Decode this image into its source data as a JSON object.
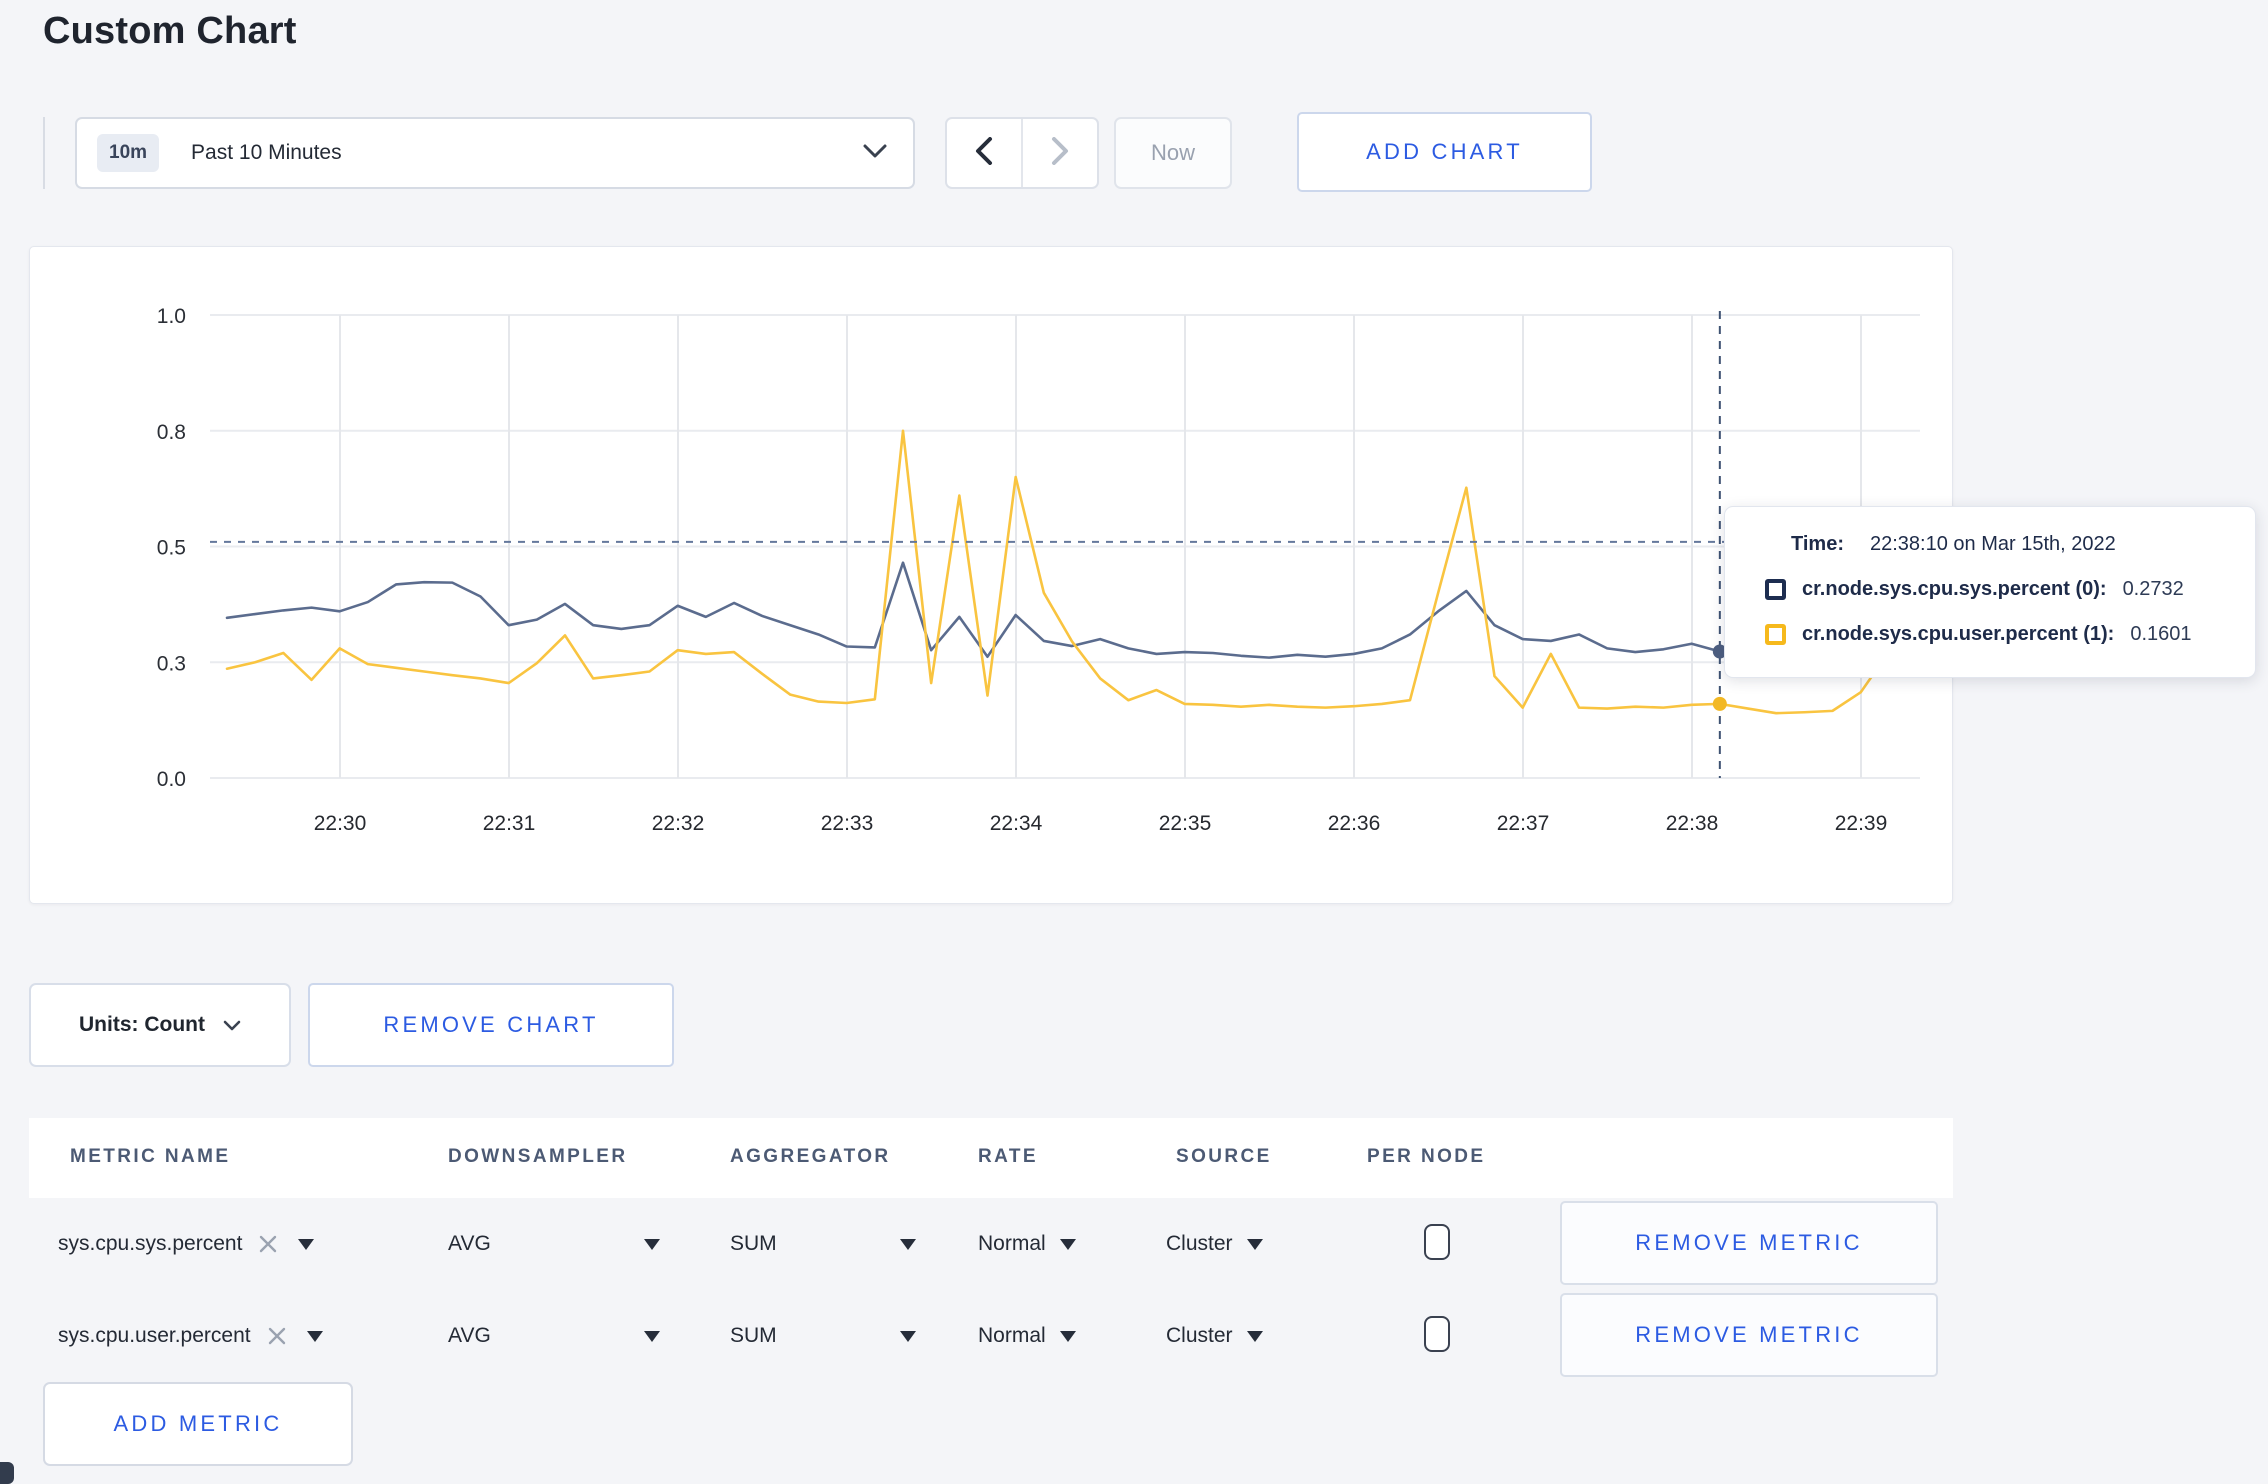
{
  "page": {
    "title": "Custom Chart",
    "background": "#f4f5f8",
    "accent_blue": "#2c5be2"
  },
  "toolbar": {
    "time_badge": "10m",
    "time_label": "Past 10 Minutes",
    "now_label": "Now",
    "add_chart_label": "ADD CHART"
  },
  "icons": {
    "time_dropdown": "chevron-down",
    "nav_prev": "chevron-left",
    "nav_next": "chevron-right",
    "units_dropdown": "chevron-down",
    "metric_clear": "x",
    "dropdown_caret": "caret-down"
  },
  "chart_data": {
    "type": "line",
    "title": "",
    "xlabel": "",
    "ylabel": "",
    "ylim": [
      0,
      1
    ],
    "grid": true,
    "x_ticks": [
      "22:30",
      "22:31",
      "22:32",
      "22:33",
      "22:34",
      "22:35",
      "22:36",
      "22:37",
      "22:38",
      "22:39"
    ],
    "y_ticks": {
      "labels": [
        "0.0",
        "0.3",
        "0.5",
        "0.8",
        "1.0"
      ],
      "values": [
        0,
        0.25,
        0.5,
        0.75,
        1.0
      ]
    },
    "x_start": "22:29:20",
    "x_end": "22:39:20",
    "step_seconds": 10,
    "series": [
      {
        "name": "cr.node.sys.cpu.sys.percent (0)",
        "color": "#5b6c8e",
        "values": [
          0.346,
          0.354,
          0.362,
          0.368,
          0.36,
          0.38,
          0.418,
          0.423,
          0.422,
          0.392,
          0.33,
          0.342,
          0.376,
          0.33,
          0.322,
          0.33,
          0.372,
          0.348,
          0.378,
          0.35,
          0.33,
          0.31,
          0.284,
          0.282,
          0.465,
          0.276,
          0.348,
          0.262,
          0.352,
          0.296,
          0.285,
          0.3,
          0.28,
          0.268,
          0.272,
          0.27,
          0.264,
          0.26,
          0.266,
          0.262,
          0.268,
          0.28,
          0.31,
          0.36,
          0.404,
          0.33,
          0.3,
          0.296,
          0.31,
          0.28,
          0.272,
          0.278,
          0.29,
          0.2732,
          0.266,
          0.262,
          0.27,
          0.278,
          0.29,
          0.3,
          0.302
        ]
      },
      {
        "name": "cr.node.sys.cpu.user.percent (1)",
        "color": "#f9c440",
        "values": [
          0.236,
          0.25,
          0.27,
          0.212,
          0.28,
          0.246,
          0.238,
          0.23,
          0.222,
          0.215,
          0.205,
          0.248,
          0.308,
          0.215,
          0.222,
          0.23,
          0.276,
          0.268,
          0.272,
          0.225,
          0.18,
          0.165,
          0.162,
          0.17,
          0.75,
          0.205,
          0.61,
          0.178,
          0.65,
          0.4,
          0.295,
          0.215,
          0.168,
          0.19,
          0.16,
          0.158,
          0.154,
          0.158,
          0.154,
          0.152,
          0.155,
          0.16,
          0.168,
          0.4,
          0.627,
          0.22,
          0.152,
          0.268,
          0.152,
          0.15,
          0.154,
          0.152,
          0.158,
          0.1601,
          0.15,
          0.14,
          0.142,
          0.145,
          0.185,
          0.272,
          0.24
        ]
      }
    ],
    "hover": {
      "index": 53,
      "time": "22:38:10",
      "guide_value": 0.51,
      "dot_values": [
        0.2732,
        0.1601
      ],
      "dot_colors": [
        "#4d5e80",
        "#f2b824"
      ]
    },
    "legend_position": "tooltip"
  },
  "tooltip": {
    "time_label": "Time:",
    "time_value": "22:38:10 on Mar 15th, 2022",
    "rows": [
      {
        "label": "cr.node.sys.cpu.sys.percent (0):",
        "value": "0.2732",
        "swatch_color": "#1d2d50"
      },
      {
        "label": "cr.node.sys.cpu.user.percent (1):",
        "value": "0.1601",
        "swatch_color": "#f6b91c"
      }
    ]
  },
  "chart_footer": {
    "units_label": "Units: Count",
    "remove_chart_label": "REMOVE CHART"
  },
  "metrics_table": {
    "headers": [
      "METRIC NAME",
      "DOWNSAMPLER",
      "AGGREGATOR",
      "RATE",
      "SOURCE",
      "PER NODE"
    ],
    "remove_metric_label": "REMOVE METRIC",
    "add_metric_label": "ADD METRIC",
    "rows": [
      {
        "metric": "sys.cpu.sys.percent",
        "downsampler": "AVG",
        "aggregator": "SUM",
        "rate": "Normal",
        "source": "Cluster",
        "per_node_checked": false
      },
      {
        "metric": "sys.cpu.user.percent",
        "downsampler": "AVG",
        "aggregator": "SUM",
        "rate": "Normal",
        "source": "Cluster",
        "per_node_checked": false
      }
    ]
  }
}
